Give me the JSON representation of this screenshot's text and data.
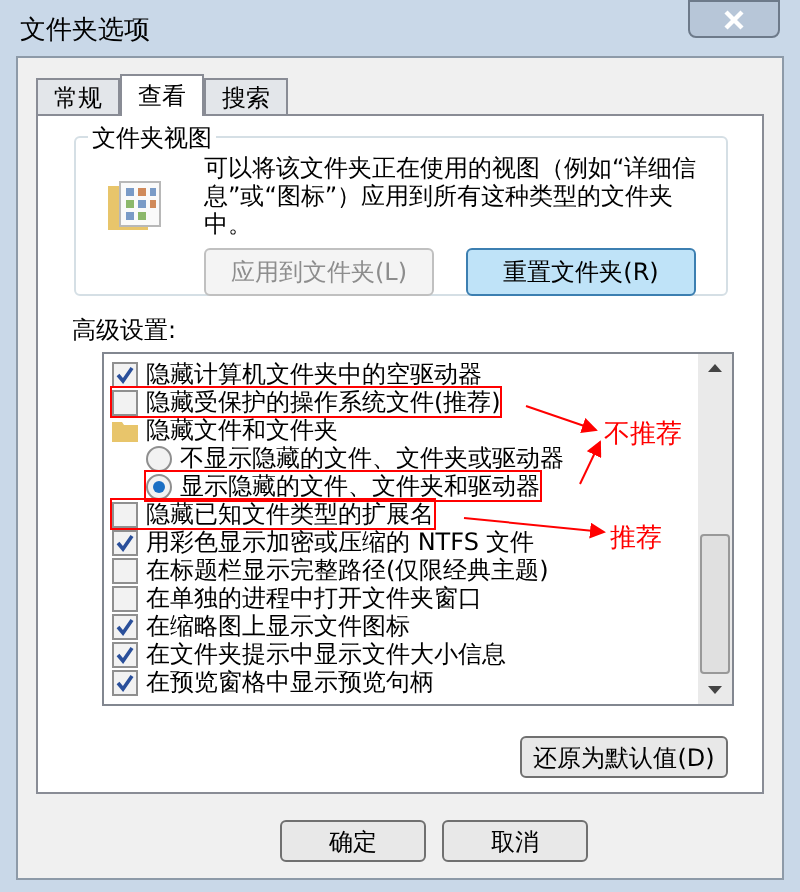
{
  "window": {
    "title": "文件夹选项"
  },
  "tabs": [
    {
      "label": "常规",
      "selected": false
    },
    {
      "label": "查看",
      "selected": true
    },
    {
      "label": "搜索",
      "selected": false
    }
  ],
  "folder_views": {
    "title": "文件夹视图",
    "description": "可以将该文件夹正在使用的视图（例如“详细信息”或“图标”）应用到所有这种类型的文件夹中。",
    "buttons": [
      {
        "label": "应用到文件夹(L)",
        "disabled": true
      },
      {
        "label": "重置文件夹(R)",
        "disabled": false
      }
    ]
  },
  "advanced": {
    "label": "高级设置:",
    "items": [
      {
        "kind": "checkbox",
        "label": "隐藏计算机文件夹中的空驱动器",
        "checked": true,
        "highlighted": false
      },
      {
        "kind": "checkbox",
        "label": "隐藏受保护的操作系统文件(推荐)",
        "checked": false,
        "highlighted": true
      },
      {
        "kind": "folder",
        "label": "隐藏文件和文件夹",
        "highlighted": false,
        "children": [
          {
            "kind": "radio",
            "label": "不显示隐藏的文件、文件夹或驱动器",
            "selected": false,
            "highlighted": false
          },
          {
            "kind": "radio",
            "label": "显示隐藏的文件、文件夹和驱动器",
            "selected": true,
            "highlighted": true
          }
        ]
      },
      {
        "kind": "checkbox",
        "label": "隐藏已知文件类型的扩展名",
        "checked": false,
        "highlighted": true
      },
      {
        "kind": "checkbox",
        "label": "用彩色显示加密或压缩的 NTFS 文件",
        "checked": true,
        "highlighted": false
      },
      {
        "kind": "checkbox",
        "label": "在标题栏显示完整路径(仅限经典主题)",
        "checked": false,
        "highlighted": false
      },
      {
        "kind": "checkbox",
        "label": "在单独的进程中打开文件夹窗口",
        "checked": false,
        "highlighted": false
      },
      {
        "kind": "checkbox",
        "label": "在缩略图上显示文件图标",
        "checked": true,
        "highlighted": false
      },
      {
        "kind": "checkbox",
        "label": "在文件夹提示中显示文件大小信息",
        "checked": true,
        "highlighted": false
      },
      {
        "kind": "checkbox",
        "label": "在预览窗格中显示预览句柄",
        "checked": true,
        "highlighted": false
      }
    ]
  },
  "restore_button": "还原为默认值(D)",
  "dialog_buttons": [
    "确定",
    "取消"
  ],
  "annotations": [
    {
      "label": "不推荐"
    },
    {
      "label": "推荐"
    }
  ]
}
